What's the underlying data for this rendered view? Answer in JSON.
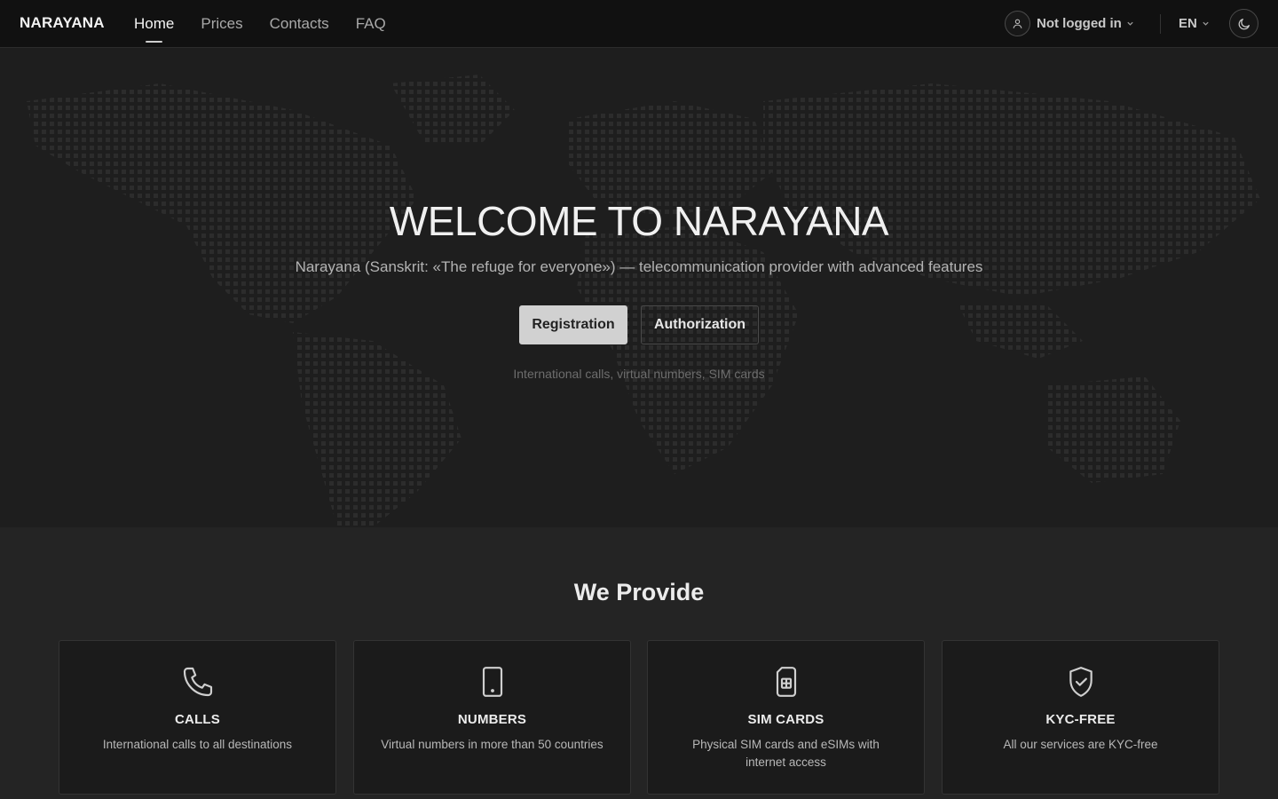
{
  "nav": {
    "brand": "NARAYANA",
    "links": [
      {
        "label": "Home",
        "active": true
      },
      {
        "label": "Prices",
        "active": false
      },
      {
        "label": "Contacts",
        "active": false
      },
      {
        "label": "FAQ",
        "active": false
      }
    ],
    "user_label": "Not logged in",
    "language": "EN",
    "icons": {
      "user": "user-icon",
      "caret": "chevron-down-icon",
      "theme": "moon-icon"
    }
  },
  "hero": {
    "title": "WELCOME TO NARAYANA",
    "subtitle": "Narayana (Sanskrit: «The refuge for everyone») — telecommunication provider with advanced features",
    "registration_label": "Registration",
    "authorization_label": "Authorization",
    "note": "International calls, virtual numbers, SIM cards"
  },
  "services": {
    "title": "We Provide",
    "items": [
      {
        "icon": "phone-icon",
        "title": "CALLS",
        "description": "International calls to all destinations"
      },
      {
        "icon": "smartphone-icon",
        "title": "NUMBERS",
        "description": "Virtual numbers in more than 50 countries"
      },
      {
        "icon": "sim-card-icon",
        "title": "SIM CARDS",
        "description": "Physical SIM cards and eSIMs with internet access"
      },
      {
        "icon": "shield-check-icon",
        "title": "KYC-FREE",
        "description": "All our services are KYC-free"
      }
    ]
  },
  "colors": {
    "nav_bg": "#111111",
    "hero_bg": "#1e1e1e",
    "page_bg": "#242424",
    "card_bg": "#1b1b1b",
    "primary_button": "#d1d1d1"
  }
}
